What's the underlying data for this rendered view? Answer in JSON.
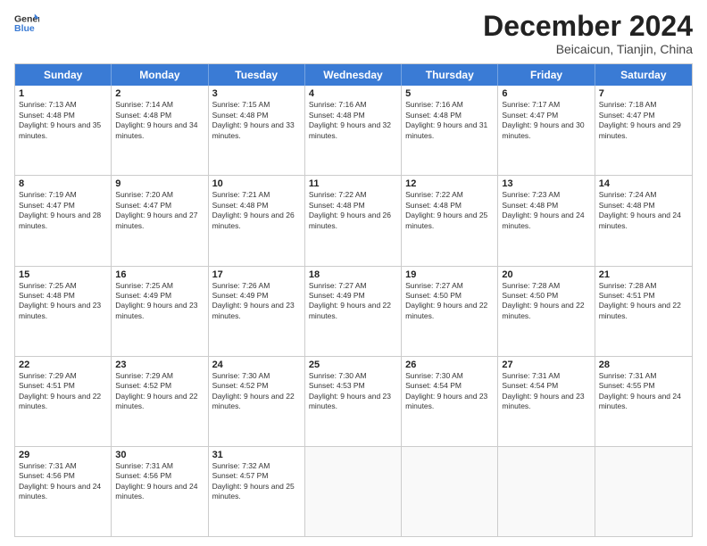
{
  "header": {
    "logo": {
      "general": "General",
      "blue": "Blue"
    },
    "month": "December 2024",
    "location": "Beicaicun, Tianjin, China"
  },
  "days_of_week": [
    "Sunday",
    "Monday",
    "Tuesday",
    "Wednesday",
    "Thursday",
    "Friday",
    "Saturday"
  ],
  "weeks": [
    [
      {
        "day": 1,
        "sunrise": "7:13 AM",
        "sunset": "4:48 PM",
        "daylight": "9 hours and 35 minutes."
      },
      {
        "day": 2,
        "sunrise": "7:14 AM",
        "sunset": "4:48 PM",
        "daylight": "9 hours and 34 minutes."
      },
      {
        "day": 3,
        "sunrise": "7:15 AM",
        "sunset": "4:48 PM",
        "daylight": "9 hours and 33 minutes."
      },
      {
        "day": 4,
        "sunrise": "7:16 AM",
        "sunset": "4:48 PM",
        "daylight": "9 hours and 32 minutes."
      },
      {
        "day": 5,
        "sunrise": "7:16 AM",
        "sunset": "4:48 PM",
        "daylight": "9 hours and 31 minutes."
      },
      {
        "day": 6,
        "sunrise": "7:17 AM",
        "sunset": "4:47 PM",
        "daylight": "9 hours and 30 minutes."
      },
      {
        "day": 7,
        "sunrise": "7:18 AM",
        "sunset": "4:47 PM",
        "daylight": "9 hours and 29 minutes."
      }
    ],
    [
      {
        "day": 8,
        "sunrise": "7:19 AM",
        "sunset": "4:47 PM",
        "daylight": "9 hours and 28 minutes."
      },
      {
        "day": 9,
        "sunrise": "7:20 AM",
        "sunset": "4:47 PM",
        "daylight": "9 hours and 27 minutes."
      },
      {
        "day": 10,
        "sunrise": "7:21 AM",
        "sunset": "4:48 PM",
        "daylight": "9 hours and 26 minutes."
      },
      {
        "day": 11,
        "sunrise": "7:22 AM",
        "sunset": "4:48 PM",
        "daylight": "9 hours and 26 minutes."
      },
      {
        "day": 12,
        "sunrise": "7:22 AM",
        "sunset": "4:48 PM",
        "daylight": "9 hours and 25 minutes."
      },
      {
        "day": 13,
        "sunrise": "7:23 AM",
        "sunset": "4:48 PM",
        "daylight": "9 hours and 24 minutes."
      },
      {
        "day": 14,
        "sunrise": "7:24 AM",
        "sunset": "4:48 PM",
        "daylight": "9 hours and 24 minutes."
      }
    ],
    [
      {
        "day": 15,
        "sunrise": "7:25 AM",
        "sunset": "4:48 PM",
        "daylight": "9 hours and 23 minutes."
      },
      {
        "day": 16,
        "sunrise": "7:25 AM",
        "sunset": "4:49 PM",
        "daylight": "9 hours and 23 minutes."
      },
      {
        "day": 17,
        "sunrise": "7:26 AM",
        "sunset": "4:49 PM",
        "daylight": "9 hours and 23 minutes."
      },
      {
        "day": 18,
        "sunrise": "7:27 AM",
        "sunset": "4:49 PM",
        "daylight": "9 hours and 22 minutes."
      },
      {
        "day": 19,
        "sunrise": "7:27 AM",
        "sunset": "4:50 PM",
        "daylight": "9 hours and 22 minutes."
      },
      {
        "day": 20,
        "sunrise": "7:28 AM",
        "sunset": "4:50 PM",
        "daylight": "9 hours and 22 minutes."
      },
      {
        "day": 21,
        "sunrise": "7:28 AM",
        "sunset": "4:51 PM",
        "daylight": "9 hours and 22 minutes."
      }
    ],
    [
      {
        "day": 22,
        "sunrise": "7:29 AM",
        "sunset": "4:51 PM",
        "daylight": "9 hours and 22 minutes."
      },
      {
        "day": 23,
        "sunrise": "7:29 AM",
        "sunset": "4:52 PM",
        "daylight": "9 hours and 22 minutes."
      },
      {
        "day": 24,
        "sunrise": "7:30 AM",
        "sunset": "4:52 PM",
        "daylight": "9 hours and 22 minutes."
      },
      {
        "day": 25,
        "sunrise": "7:30 AM",
        "sunset": "4:53 PM",
        "daylight": "9 hours and 23 minutes."
      },
      {
        "day": 26,
        "sunrise": "7:30 AM",
        "sunset": "4:54 PM",
        "daylight": "9 hours and 23 minutes."
      },
      {
        "day": 27,
        "sunrise": "7:31 AM",
        "sunset": "4:54 PM",
        "daylight": "9 hours and 23 minutes."
      },
      {
        "day": 28,
        "sunrise": "7:31 AM",
        "sunset": "4:55 PM",
        "daylight": "9 hours and 24 minutes."
      }
    ],
    [
      {
        "day": 29,
        "sunrise": "7:31 AM",
        "sunset": "4:56 PM",
        "daylight": "9 hours and 24 minutes."
      },
      {
        "day": 30,
        "sunrise": "7:31 AM",
        "sunset": "4:56 PM",
        "daylight": "9 hours and 24 minutes."
      },
      {
        "day": 31,
        "sunrise": "7:32 AM",
        "sunset": "4:57 PM",
        "daylight": "9 hours and 25 minutes."
      },
      null,
      null,
      null,
      null
    ]
  ]
}
